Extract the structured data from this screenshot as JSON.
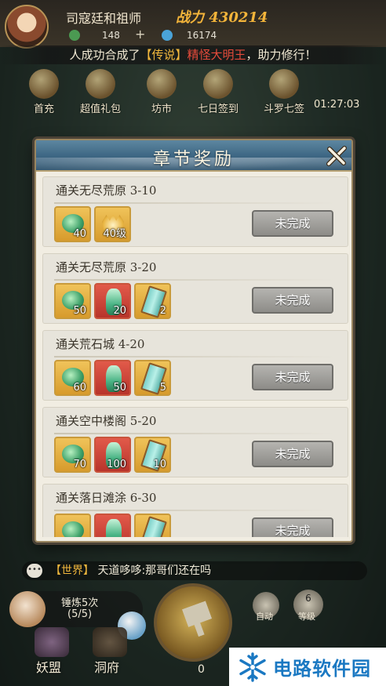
{
  "player": {
    "name": "司寇廷和祖师",
    "power": "战力 430214",
    "res_a": "148",
    "res_b": "16174"
  },
  "announcement": {
    "player": "人成功",
    "text1": "合成了",
    "tag": "【传说】",
    "item": "精怪大明王",
    "text2": "，助力修行！"
  },
  "menu": {
    "items": [
      {
        "label": "首充"
      },
      {
        "label": "超值礼包"
      },
      {
        "label": "坊市"
      },
      {
        "label": "七日签到"
      },
      {
        "label": "斗罗七签"
      }
    ],
    "timer": "01:27:03"
  },
  "dialog": {
    "title": "章节奖励",
    "rows": [
      {
        "title": "通关无尽荒原 3-10",
        "items": [
          {
            "type": "jade",
            "bg": "gold",
            "count": "40"
          },
          {
            "type": "crown",
            "bg": "gold",
            "count": "40级"
          }
        ],
        "status": "未完成"
      },
      {
        "title": "通关无尽荒原 3-20",
        "items": [
          {
            "type": "jade",
            "bg": "gold",
            "count": "50"
          },
          {
            "type": "vase",
            "bg": "red",
            "count": "20"
          },
          {
            "type": "scroll",
            "bg": "gold",
            "count": "2"
          }
        ],
        "status": "未完成"
      },
      {
        "title": "通关荒石城 4-20",
        "items": [
          {
            "type": "jade",
            "bg": "gold",
            "count": "60"
          },
          {
            "type": "vase",
            "bg": "red",
            "count": "50"
          },
          {
            "type": "scroll",
            "bg": "gold",
            "count": "5"
          }
        ],
        "status": "未完成"
      },
      {
        "title": "通关空中楼阁 5-20",
        "items": [
          {
            "type": "jade",
            "bg": "gold",
            "count": "70"
          },
          {
            "type": "vase",
            "bg": "red",
            "count": "100"
          },
          {
            "type": "scroll",
            "bg": "gold",
            "count": "10"
          }
        ],
        "status": "未完成"
      },
      {
        "title": "通关落日滩涂 6-30",
        "items": [
          {
            "type": "jade",
            "bg": "gold",
            "count": ""
          },
          {
            "type": "vase",
            "bg": "red",
            "count": ""
          },
          {
            "type": "scroll",
            "bg": "gold",
            "count": ""
          }
        ],
        "status": "未完成"
      }
    ]
  },
  "chat": {
    "channel": "【世界】",
    "message": "天道哆哆:那哥们还在吗"
  },
  "smelt": {
    "label": "锤炼5次",
    "count": "(5/5)"
  },
  "forge": {
    "count": "0"
  },
  "controls": {
    "auto": "自动",
    "level_num": "6",
    "level": "等级"
  },
  "bottom_nav": [
    {
      "label": "妖盟"
    },
    {
      "label": "洞府"
    }
  ],
  "watermark": {
    "text": "电路软件园"
  },
  "colors": {
    "dialog_bg": "#f1ede2",
    "header_blue": "#3c6582",
    "status_gray": "#9c9b97",
    "highlight_red": "#e74b3b",
    "highlight_gold": "#f1b73d"
  }
}
